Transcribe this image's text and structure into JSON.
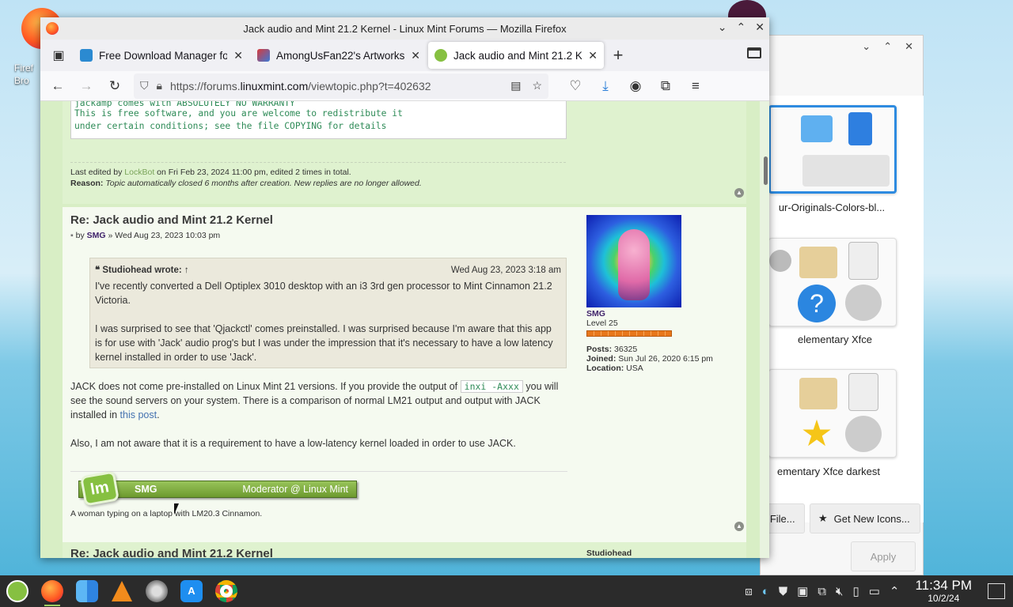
{
  "desktop": {
    "icon_label": "Firef\nBro"
  },
  "bg_window": {
    "theme_labels": [
      "ur-Originals-Colors-bl...",
      "elementary Xfce",
      "ementary Xfce darkest"
    ],
    "file_button": "n File...",
    "new_icons_button": "Get New Icons...",
    "apply_button": "Apply"
  },
  "firefox": {
    "title": "Jack audio and Mint 21.2 Kernel - Linux Mint Forums — Mozilla Firefox",
    "tabs": [
      {
        "label": "Free Download Manager fo",
        "active": false,
        "fav_color": "#2b8ad1"
      },
      {
        "label": "AmongUsFan22's Artworks",
        "active": false,
        "fav_color": "#d93a3a"
      },
      {
        "label": "Jack audio and Mint 21.2 K",
        "active": true,
        "fav_color": "#86c041"
      }
    ],
    "url": {
      "prefix": "https://forums.",
      "host": "linuxmint.com",
      "path": "/viewtopic.php?t=402632"
    }
  },
  "page": {
    "post1": {
      "code_lines": [
        "jackamp comes with ABSOLUTELY NO WARRANTY",
        "This is free software, and you are welcome to redistribute it",
        "under certain conditions; see the file COPYING for details"
      ],
      "edit_prefix": "Last edited by ",
      "edit_user": "LockBot",
      "edit_suffix": " on Fri Feb 23, 2024 11:00 pm, edited 2 times in total.",
      "reason_label": "Reason:",
      "reason_text": " Topic automatically closed 6 months after creation. New replies are no longer allowed."
    },
    "post2": {
      "title": "Re: Jack audio and Mint 21.2 Kernel",
      "by": "by ",
      "author": "SMG",
      "date": " » Wed Aug 23, 2023 10:03 pm",
      "quote": {
        "author": "Studiohead wrote: ↑",
        "date": "Wed Aug 23, 2023 3:18 am",
        "p1": "I've recently converted a Dell Optiplex 3010 desktop with an i3 3rd gen processor to Mint Cinnamon 21.2 Victoria.",
        "p2": "I was surprised to see that 'Qjackctl' comes preinstalled. I was surprised because I'm aware that this app is for use with 'Jack' audio prog's but I was under the impression that it's necessary to have a low latency kernel installed in order to use 'Jack'."
      },
      "body1_a": "JACK does not come pre-installed on Linux Mint 21 versions. If you provide the output of ",
      "body1_code": "inxi -Axxx",
      "body1_b": " you will see the sound servers on your system. There is a comparison of normal LM21 output and output with JACK installed in ",
      "body1_link": "this post",
      "body1_c": ".",
      "body2": "Also, I am not aware that it is a requirement to have a low-latency kernel loaded in order to use JACK.",
      "sig_name": "SMG",
      "sig_role": "Moderator @ Linux Mint",
      "sig_caption": "A woman typing on a laptop with LM20.3 Cinnamon.",
      "profile": {
        "name": "SMG",
        "rank": "Level 25",
        "posts_label": "Posts:",
        "posts": " 36325",
        "joined_label": "Joined:",
        "joined": " Sun Jul 26, 2020 6:15 pm",
        "location_label": "Location:",
        "location": " USA"
      }
    },
    "post3": {
      "title": "Re: Jack audio and Mint 21.2 Kernel",
      "author": "Studiohead"
    }
  },
  "taskbar": {
    "apps": [
      "mint-menu",
      "firefox",
      "finder",
      "vlc",
      "system-settings",
      "app-store",
      "chrome"
    ],
    "time": "11:34 PM",
    "date": "10/2/24"
  }
}
